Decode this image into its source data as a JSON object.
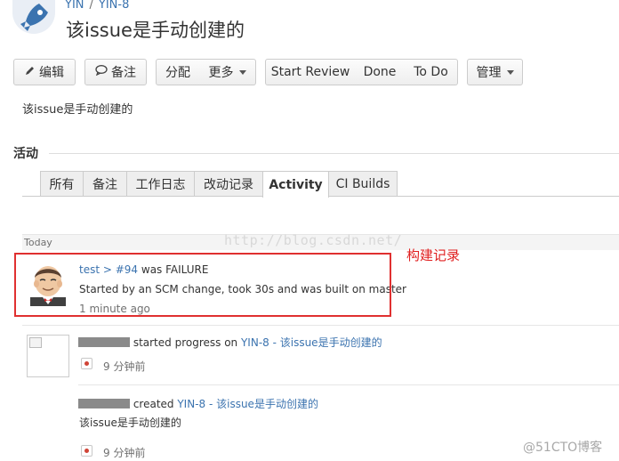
{
  "header": {
    "breadcrumb": [
      "YIN",
      "YIN-8"
    ],
    "breadcrumb_separator": "/",
    "title": "该issue是手动创建的"
  },
  "toolbar": {
    "edit_label": "编辑",
    "comment_label": "备注",
    "assign_label": "分配",
    "more_label": "更多",
    "start_review_label": "Start Review",
    "done_label": "Done",
    "todo_label": "To Do",
    "admin_label": "管理"
  },
  "description": "该issue是手动创建的",
  "activity": {
    "section_title": "活动",
    "tabs": [
      "所有",
      "备注",
      "工作日志",
      "改动记录",
      "Activity",
      "CI Builds"
    ],
    "active_tab": "Activity",
    "today_label": "Today",
    "watermark_url": "http://blog.csdn.net/",
    "annotation": "构建记录",
    "build_entry": {
      "job_link": "test > #94",
      "status_text": " was FAILURE",
      "detail": "Started by an SCM change, took 30s and was built on master",
      "time": "1 minute ago"
    },
    "progress_entry": {
      "action": " started progress on ",
      "issue_link": "YIN-8 - 该issue是手动创建的",
      "time": "9 分钟前"
    },
    "created_entry": {
      "action": " created ",
      "issue_link": "YIN-8 - 该issue是手动创建的",
      "body": "该issue是手动创建的",
      "time": "9 分钟前"
    }
  },
  "corner_watermark": "@51CTO博客",
  "colors": {
    "link": "#3b73af",
    "annotation_red": "#e03030",
    "failure_dot": "#d04437"
  }
}
